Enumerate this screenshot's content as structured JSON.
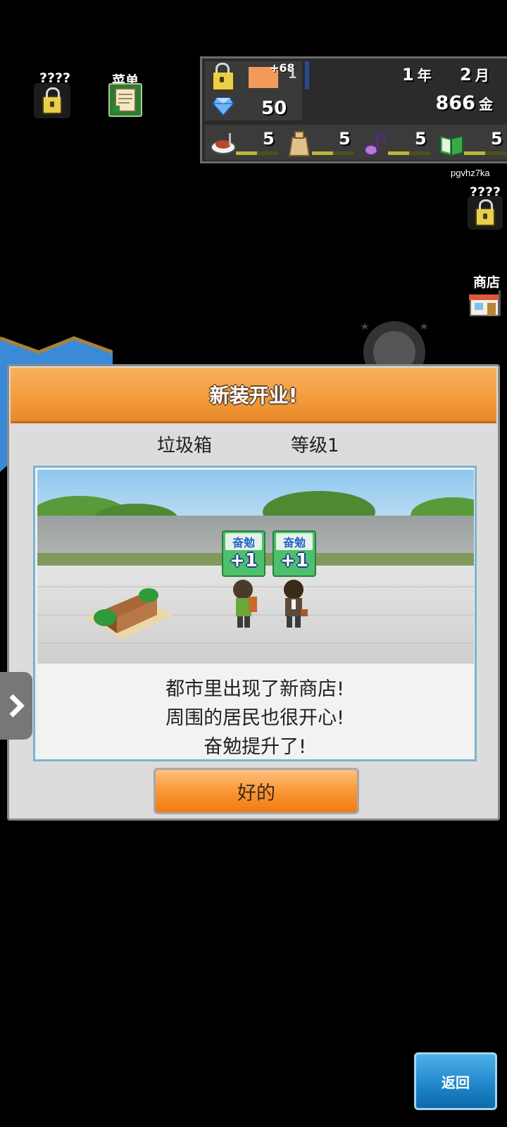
{
  "top_left": {
    "locked_label": "????",
    "menu_label": "菜单"
  },
  "status": {
    "bonus": "+68",
    "level_value": "1",
    "gems": "50",
    "year": "1",
    "year_unit": "年",
    "month": "2",
    "month_unit": "月",
    "money": "866",
    "money_unit": "金",
    "stats": [
      {
        "icon": "food-icon",
        "value": "5",
        "fill": 0.5
      },
      {
        "icon": "bag-icon",
        "value": "5",
        "fill": 0.5
      },
      {
        "icon": "music-note-icon",
        "value": "5",
        "fill": 0.5
      },
      {
        "icon": "book-icon",
        "value": "5",
        "fill": 0.5
      }
    ],
    "username": "pgvhz7ka"
  },
  "right_side": {
    "locked_label": "????",
    "shop_label": "商店"
  },
  "dialog": {
    "title": "新装开业!",
    "facility_name": "垃圾箱",
    "facility_level": "等级1",
    "badges": [
      {
        "label": "奋勉",
        "value": "+1"
      },
      {
        "label": "奋勉",
        "value": "+1"
      }
    ],
    "message_lines": [
      "都市里出现了新商店!",
      "周围的居民也很开心!",
      "奋勉提升了!"
    ],
    "ok_label": "好的"
  },
  "return_label": "返回",
  "colors": {
    "header_orange": "#f29b3c",
    "return_blue": "#1d85c8",
    "badge_green": "#4cc06a"
  }
}
